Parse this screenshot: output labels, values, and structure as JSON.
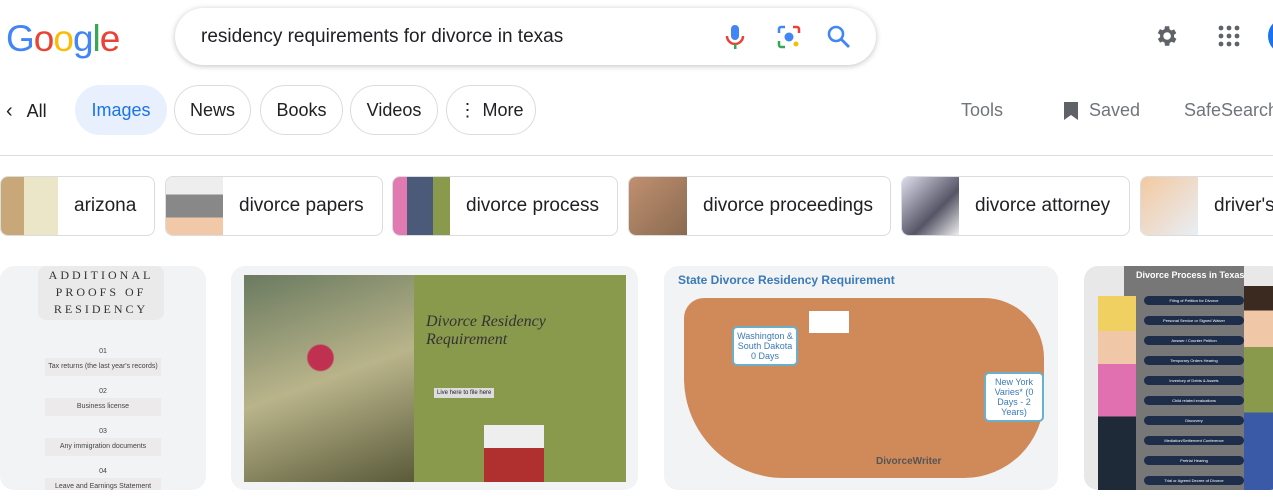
{
  "logo": "Google",
  "search": {
    "query": "residency requirements for divorce in texas"
  },
  "tabs": [
    {
      "label": "All"
    },
    {
      "label": "Images"
    },
    {
      "label": "News"
    },
    {
      "label": "Books"
    },
    {
      "label": "Videos"
    },
    {
      "label": "More"
    }
  ],
  "tools": {
    "tools": "Tools",
    "saved": "Saved",
    "safesearch": "SafeSearch"
  },
  "chips": [
    {
      "label": "arizona"
    },
    {
      "label": "divorce papers"
    },
    {
      "label": "divorce process"
    },
    {
      "label": "divorce proceedings"
    },
    {
      "label": "divorce attorney"
    },
    {
      "label": "driver's"
    }
  ],
  "results": [
    {
      "title": "ADDITIONAL PROOFS OF RESIDENCY",
      "items": [
        {
          "n": "01",
          "t": "Tax returns (the last year's records)"
        },
        {
          "n": "02",
          "t": "Business license"
        },
        {
          "n": "03",
          "t": "Any immigration documents"
        },
        {
          "n": "04",
          "t": "Leave and Earnings Statement"
        }
      ]
    },
    {
      "title": "Divorce Residency Requirement",
      "button": "Live here to file here"
    },
    {
      "title": "State Divorce Residency Requirement",
      "callout1": "Washington & South Dakota 0 Days",
      "callout2": "New York Varies* (0 Days - 2 Years)",
      "brand": "DivorceWriter"
    },
    {
      "title": "Divorce Process in Texas",
      "steps": [
        "Filing of Petition for Divorce",
        "Personal Service or Signed Waiver",
        "Answer / Counter Petition",
        "Temporary Orders Hearing",
        "Inventory of Debts & Assets",
        "Child related evaluations",
        "Discovery",
        "Mediation/Settlement Conference",
        "Pretrial Hearing",
        "Trial or Agreed Decree of Divorce"
      ]
    }
  ],
  "colors": {
    "accent": "#1a73e8",
    "active_tab_bg": "#e8f0fe",
    "map": "#d08a5a",
    "olive": "#8a9a4c"
  }
}
